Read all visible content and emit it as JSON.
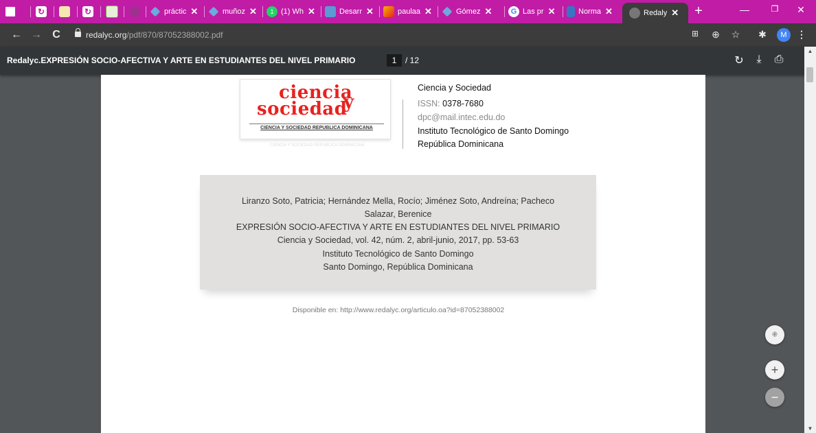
{
  "tabs": [
    {
      "label": "",
      "icon": "app-icon"
    },
    {
      "label": "",
      "icon": "sync-icon"
    },
    {
      "label": "",
      "icon": "note-icon"
    },
    {
      "label": "",
      "icon": "sync-icon"
    },
    {
      "label": "",
      "icon": "image-icon"
    },
    {
      "label": "",
      "icon": "globe-icon"
    },
    {
      "label": "práctic",
      "icon": "diamond-icon"
    },
    {
      "label": "muñoz",
      "icon": "diamond-icon"
    },
    {
      "label": "(1) Wh",
      "icon": "whatsapp-icon"
    },
    {
      "label": "Desarr",
      "icon": "doc-icon"
    },
    {
      "label": "paulaa",
      "icon": "pen-icon"
    },
    {
      "label": "Gómez",
      "icon": "diamond-icon"
    },
    {
      "label": "Las pr",
      "icon": "google-icon"
    },
    {
      "label": "Norma",
      "icon": "doc-icon"
    },
    {
      "label": "Redaly",
      "icon": "globe-icon",
      "active": true
    }
  ],
  "address": {
    "domain": "redalyc.org",
    "path": "/pdf/870/87052388002.pdf"
  },
  "profile": {
    "initial": "M"
  },
  "pdf": {
    "title": "Redalyc.EXPRESIÓN SOCIO-AFECTIVA Y ARTE EN ESTUDIANTES DEL NIVEL PRIMARIO",
    "page_current": "1",
    "page_total": "/ 12"
  },
  "journal": {
    "logo_word1": "ciencia",
    "logo_word2": "sociedad",
    "logo_word3": "y",
    "logo_subtitle": "CIENCIA Y SOCIEDAD REPUBLICA DOMINICANA",
    "name": "Ciencia y Sociedad",
    "issn_label": "ISSN: ",
    "issn": "0378-7680",
    "email": "dpc@mail.intec.edu.do",
    "institute": "Instituto Tecnológico de Santo Domingo",
    "country": "República Dominicana"
  },
  "citation": {
    "authors_line1": "Liranzo Soto, Patricia; Hernández Mella, Rocío; Jiménez Soto, Andreína; Pacheco",
    "authors_line2": "Salazar, Berenice",
    "title": "EXPRESIÓN SOCIO-AFECTIVA Y ARTE EN ESTUDIANTES DEL NIVEL PRIMARIO",
    "source": "Ciencia y Sociedad, vol. 42, núm. 2, abril-junio, 2017, pp. 53-63",
    "institute": "Instituto Tecnológico de Santo Domingo",
    "location": "Santo Domingo, República Dominicana"
  },
  "available": "Disponible en: http://www.redalyc.org/articulo.oa?id=87052388002",
  "colors": {
    "tabstrip": "#c01ca6",
    "toolbar": "#3c3c3c",
    "pdf_toolbar": "#323639",
    "viewer_bg": "#525659",
    "logo_red": "#e8221f"
  }
}
